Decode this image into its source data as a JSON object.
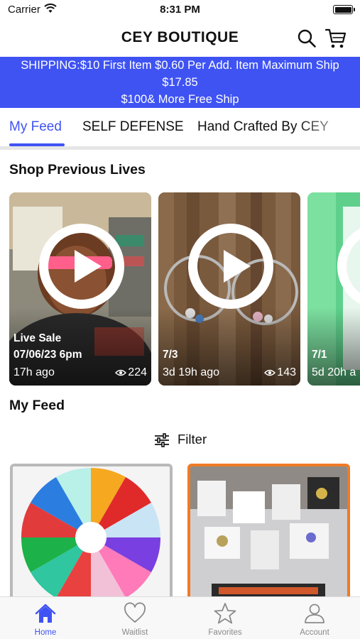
{
  "status_bar": {
    "carrier": "Carrier",
    "time": "8:31 PM"
  },
  "header": {
    "title": "CEY BOUTIQUE",
    "search_icon": "search-icon",
    "cart_icon": "cart-icon"
  },
  "banner": {
    "lines": [
      "SHIPPING:$10 First Item $0.60  Per Add. Item Maximum Ship",
      "$17.85",
      "$100& More Free Ship"
    ],
    "background": "#3f53f3"
  },
  "tabs": [
    {
      "label": "My Feed",
      "active": true
    },
    {
      "label": "SELF DEFENSE",
      "active": false
    },
    {
      "label": "Hand Crafted By CEY",
      "active": false
    }
  ],
  "lives_section": {
    "title": "Shop Previous Lives",
    "cards": [
      {
        "line1": "Live Sale",
        "line2": "07/06/23 6pm",
        "ago": "17h ago",
        "views": "224"
      },
      {
        "line1": "",
        "line2": "7/3",
        "ago": "3d 19h ago",
        "views": "143"
      },
      {
        "line1": "",
        "line2": "7/1",
        "ago": "5d 20h a",
        "views": ""
      }
    ]
  },
  "feed_section": {
    "title": "My Feed",
    "filter_label": "Filter"
  },
  "bottom_nav": [
    {
      "label": "Home",
      "icon": "home-icon",
      "active": true
    },
    {
      "label": "Waitlist",
      "icon": "heart-icon",
      "active": false
    },
    {
      "label": "Favorites",
      "icon": "star-icon",
      "active": false
    },
    {
      "label": "Account",
      "icon": "account-icon",
      "active": false
    }
  ],
  "colors": {
    "accent": "#3f53f3",
    "product_border_orange": "#f07a25"
  }
}
